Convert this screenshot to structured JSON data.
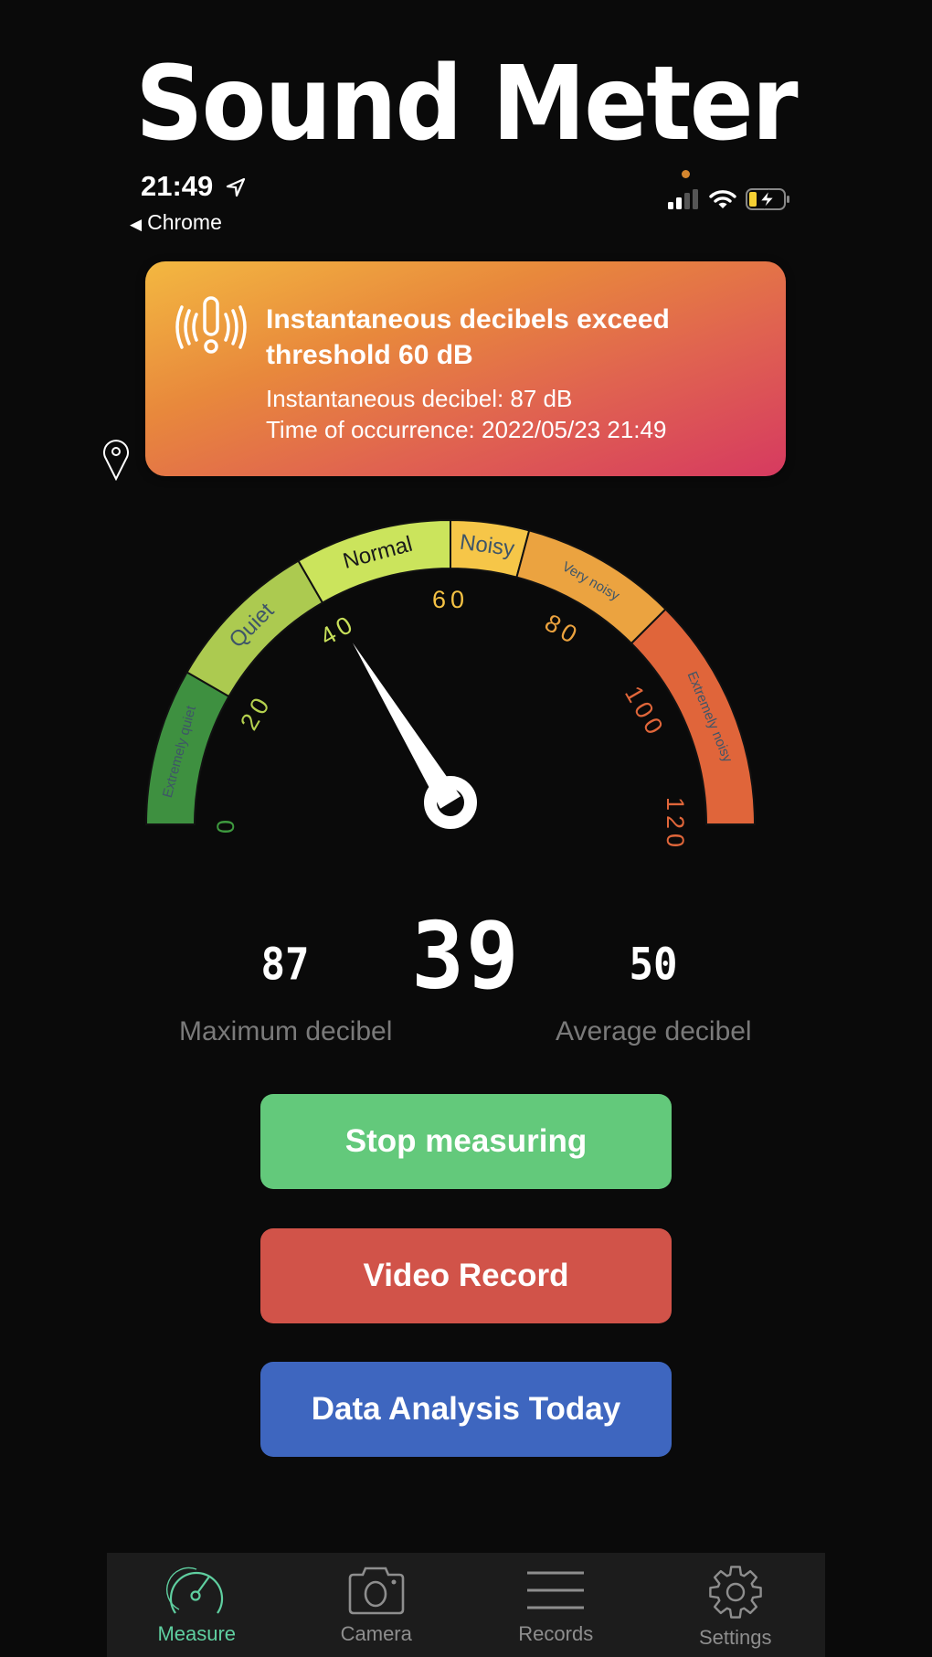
{
  "app": {
    "title": "Sound Meter"
  },
  "status_bar": {
    "time": "21:49",
    "back_app": "Chrome",
    "location_icon": "location-arrow-icon",
    "signal_icon": "cellular-signal-icon",
    "wifi_icon": "wifi-icon",
    "battery_icon": "battery-charging-icon",
    "battery_color": "#f5d033"
  },
  "notification": {
    "icon": "alert-vibration-icon",
    "title": "Instantaneous decibels exceed threshold 60 dB",
    "line1": "Instantaneous decibel: 87 dB",
    "line2": "Time of occurrence: 2022/05/23 21:49"
  },
  "gauge": {
    "min": 0,
    "max": 120,
    "value": 39,
    "unit": "dB",
    "ticks": [
      {
        "value": 0,
        "label": "0",
        "color": "#3e9a3f"
      },
      {
        "value": 20,
        "label": "20",
        "color": "#b4d04e"
      },
      {
        "value": 40,
        "label": "40",
        "color": "#c8e05a"
      },
      {
        "value": 60,
        "label": "60",
        "color": "#f5c244"
      },
      {
        "value": 80,
        "label": "80",
        "color": "#eba23e"
      },
      {
        "value": 100,
        "label": "100",
        "color": "#e0663a"
      },
      {
        "value": 120,
        "label": "120",
        "color": "#e0663a"
      }
    ],
    "bands": [
      {
        "from": 0,
        "to": 20,
        "label": "Extremely quiet",
        "color": "#3e9040"
      },
      {
        "from": 20,
        "to": 40,
        "label": "Quiet",
        "color": "#acca50"
      },
      {
        "from": 40,
        "to": 60,
        "label": "Normal",
        "color": "#cbe45c"
      },
      {
        "from": 60,
        "to": 70,
        "label": "Noisy",
        "color": "#f6c648"
      },
      {
        "from": 70,
        "to": 90,
        "label": "Very noisy",
        "color": "#eba340"
      },
      {
        "from": 90,
        "to": 120,
        "label": "Extremely noisy",
        "color": "#e0653a"
      }
    ]
  },
  "readouts": {
    "max_value": "87",
    "current_value": "39",
    "avg_value": "50",
    "max_label": "Maximum decibel",
    "avg_label": "Average decibel"
  },
  "buttons": {
    "stop": "Stop measuring",
    "video": "Video Record",
    "analysis": "Data Analysis Today"
  },
  "tabbar": {
    "active_color": "#5fcfa0",
    "inactive_color": "#8e8e8e",
    "items": [
      {
        "label": "Measure",
        "icon": "speedometer-icon",
        "active": true
      },
      {
        "label": "Camera",
        "icon": "camera-icon",
        "active": false
      },
      {
        "label": "Records",
        "icon": "list-icon",
        "active": false
      },
      {
        "label": "Settings",
        "icon": "gear-icon",
        "active": false
      }
    ]
  }
}
